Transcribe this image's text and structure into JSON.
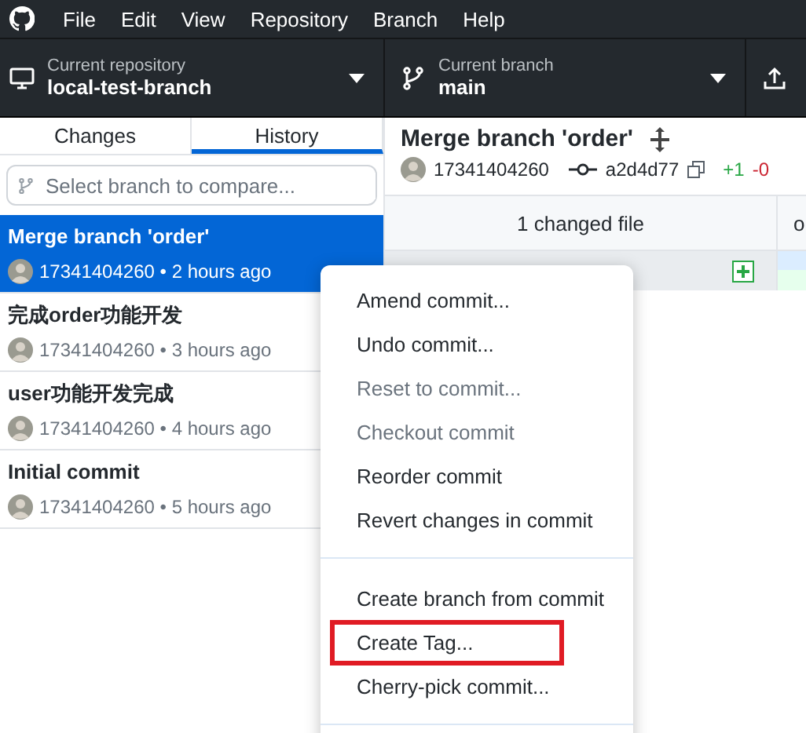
{
  "menu_bar": [
    "File",
    "Edit",
    "View",
    "Repository",
    "Branch",
    "Help"
  ],
  "toolbar": {
    "repository": {
      "label": "Current repository",
      "value": "local-test-branch"
    },
    "branch": {
      "label": "Current branch",
      "value": "main"
    }
  },
  "sidebar": {
    "tabs": [
      {
        "label": "Changes",
        "selected": false
      },
      {
        "label": "History",
        "selected": true
      }
    ],
    "search": {
      "placeholder": "Select branch to compare..."
    },
    "commits": [
      {
        "title": "Merge branch 'order'",
        "author": "17341404260",
        "bullet": "•",
        "time": "2 hours ago",
        "selected": true
      },
      {
        "title": "完成order功能开发",
        "author": "17341404260",
        "bullet": "•",
        "time": "3 hours ago",
        "selected": false
      },
      {
        "title": "user功能开发完成",
        "author": "17341404260",
        "bullet": "•",
        "time": "4 hours ago",
        "selected": false
      },
      {
        "title": "Initial commit",
        "author": "17341404260",
        "bullet": "•",
        "time": "5 hours ago",
        "selected": false
      }
    ]
  },
  "commit_detail": {
    "title": "Merge branch 'order'",
    "author": "17341404260",
    "sha": "a2d4d77",
    "additions": "+1",
    "deletions": "-0"
  },
  "files": {
    "heading": "1 changed file",
    "column_2": "o"
  },
  "context_menu": [
    {
      "kind": "item",
      "label": "Amend commit...",
      "disabled": false,
      "highlighted": false
    },
    {
      "kind": "item",
      "label": "Undo commit...",
      "disabled": false,
      "highlighted": false
    },
    {
      "kind": "item",
      "label": "Reset to commit...",
      "disabled": true,
      "highlighted": false
    },
    {
      "kind": "item",
      "label": "Checkout commit",
      "disabled": true,
      "highlighted": false
    },
    {
      "kind": "item",
      "label": "Reorder commit",
      "disabled": false,
      "highlighted": false
    },
    {
      "kind": "item",
      "label": "Revert changes in commit",
      "disabled": false,
      "highlighted": false
    },
    {
      "kind": "separator"
    },
    {
      "kind": "item",
      "label": "Create branch from commit",
      "disabled": false,
      "highlighted": false
    },
    {
      "kind": "item",
      "label": "Create Tag...",
      "disabled": false,
      "highlighted": true
    },
    {
      "kind": "item",
      "label": "Cherry-pick commit...",
      "disabled": false,
      "highlighted": false
    },
    {
      "kind": "separator"
    }
  ]
}
